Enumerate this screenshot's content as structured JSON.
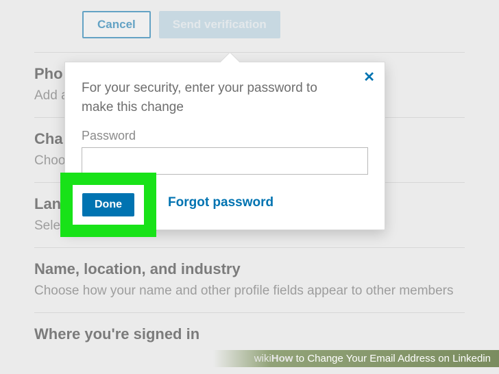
{
  "buttons": {
    "cancel": "Cancel",
    "send_verification": "Send verification"
  },
  "popover": {
    "message": "For your security, enter your password to make this change",
    "password_label": "Password",
    "password_value": "",
    "done": "Done",
    "forgot": "Forgot password"
  },
  "sections": [
    {
      "heading": "Pho",
      "body": "Add a phone number in case you have trouble signing in"
    },
    {
      "heading": "Cha",
      "body": "Choose a unique password to protect your account"
    },
    {
      "heading": "Language",
      "body": "Select the language you use on LinkedIn"
    },
    {
      "heading": "Name, location, and industry",
      "body": "Choose how your name and other profile fields appear to other members"
    },
    {
      "heading": "Where you're signed in",
      "body": ""
    }
  ],
  "caption": {
    "brand": "wikiHow",
    "title": " to Change Your Email Address on Linkedin"
  }
}
